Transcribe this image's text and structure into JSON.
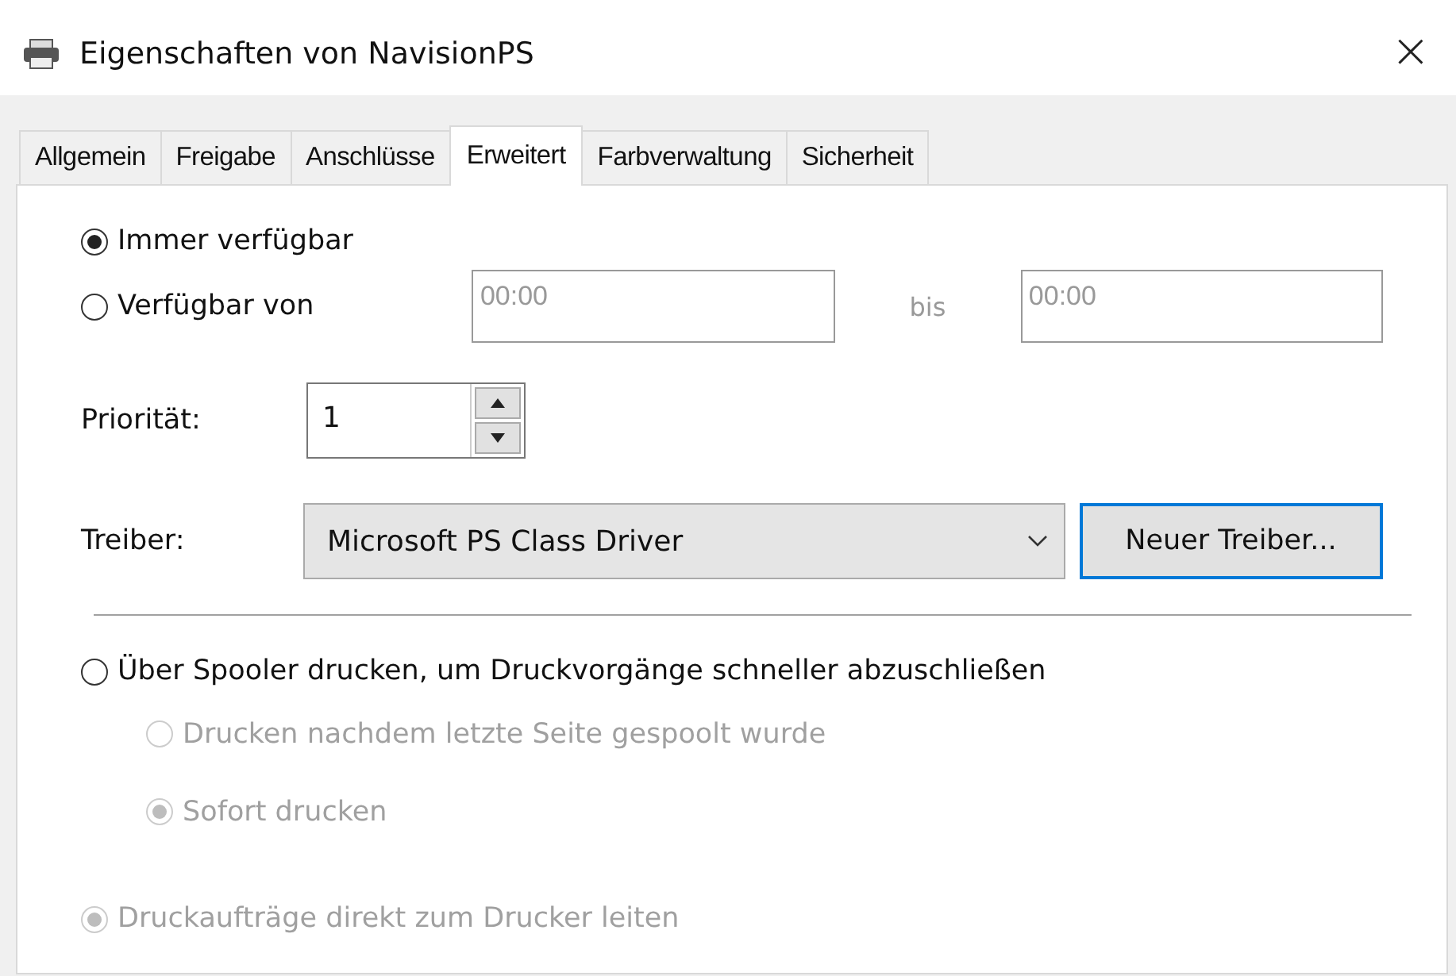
{
  "window": {
    "title": "Eigenschaften von NavisionPS",
    "close": "×"
  },
  "tabs": [
    {
      "label": "Allgemein",
      "selected": false
    },
    {
      "label": "Freigabe",
      "selected": false
    },
    {
      "label": "Anschlüsse",
      "selected": false
    },
    {
      "label": "Erweitert",
      "selected": true
    },
    {
      "label": "Farbverwaltung",
      "selected": false
    },
    {
      "label": "Sicherheit",
      "selected": false
    }
  ],
  "availability": [
    {
      "label": "Immer verfügbar",
      "selected": true,
      "disabled": false
    },
    {
      "label": "Verfügbar von",
      "selected": false,
      "disabled": false
    }
  ],
  "time_from": {
    "value": "00:00",
    "disabled": true
  },
  "time_separator": "bis",
  "time_to": {
    "value": "00:00",
    "disabled": true
  },
  "priority": {
    "label": "Priorität:",
    "value": "1"
  },
  "driver": {
    "label": "Treiber:",
    "value": "Microsoft PS Class Driver",
    "button": "Neuer Treiber..."
  },
  "spooling": [
    {
      "label": "Über Spooler drucken, um Druckvorgänge schneller abzuschließen",
      "selected": false,
      "disabled": false,
      "children": [
        {
          "label": "Drucken nachdem letzte Seite gespoolt wurde",
          "selected": false,
          "disabled": true
        },
        {
          "label": "Sofort drucken",
          "selected": true,
          "disabled": true
        }
      ]
    },
    {
      "label": "Druckaufträge direkt zum Drucker leiten",
      "selected": true,
      "disabled": true
    }
  ]
}
